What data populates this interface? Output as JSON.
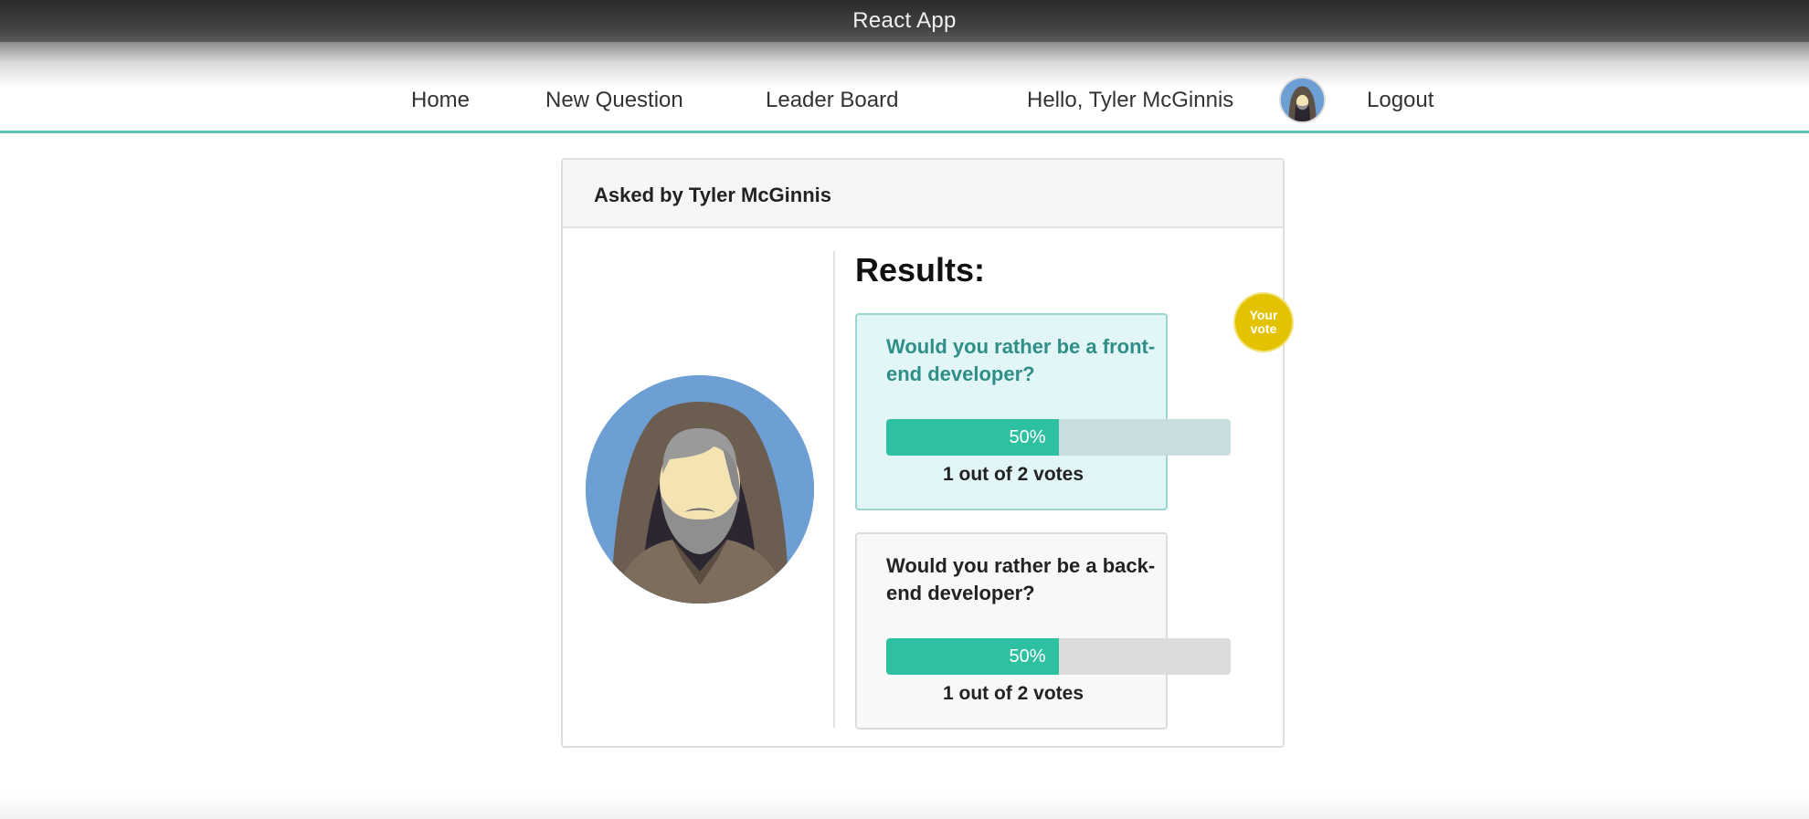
{
  "window": {
    "title": "React App"
  },
  "nav": {
    "home": "Home",
    "new_question": "New Question",
    "leader_board": "Leader Board",
    "greeting": "Hello, Tyler McGinnis",
    "logout": "Logout",
    "avatar_icon": "user-avatar-icon"
  },
  "card": {
    "asked_by": "Asked by Tyler McGinnis",
    "results_title": "Results:",
    "badge": {
      "line1": "Your",
      "line2": "vote"
    },
    "options": [
      {
        "text": "Would you rather be a front-end developer?",
        "percent_label": "50%",
        "percent": 0.5,
        "votes_text": "1 out of 2 votes",
        "your_vote": true
      },
      {
        "text": "Would you rather be a back-end developer?",
        "percent_label": "50%",
        "percent": 0.5,
        "votes_text": "1 out of 2 votes",
        "your_vote": false
      }
    ]
  },
  "colors": {
    "accent": "#2ec1a1",
    "nav_border": "#5cc4b5",
    "badge": "#e3c300",
    "voted_bg": "#e2f6f7"
  }
}
